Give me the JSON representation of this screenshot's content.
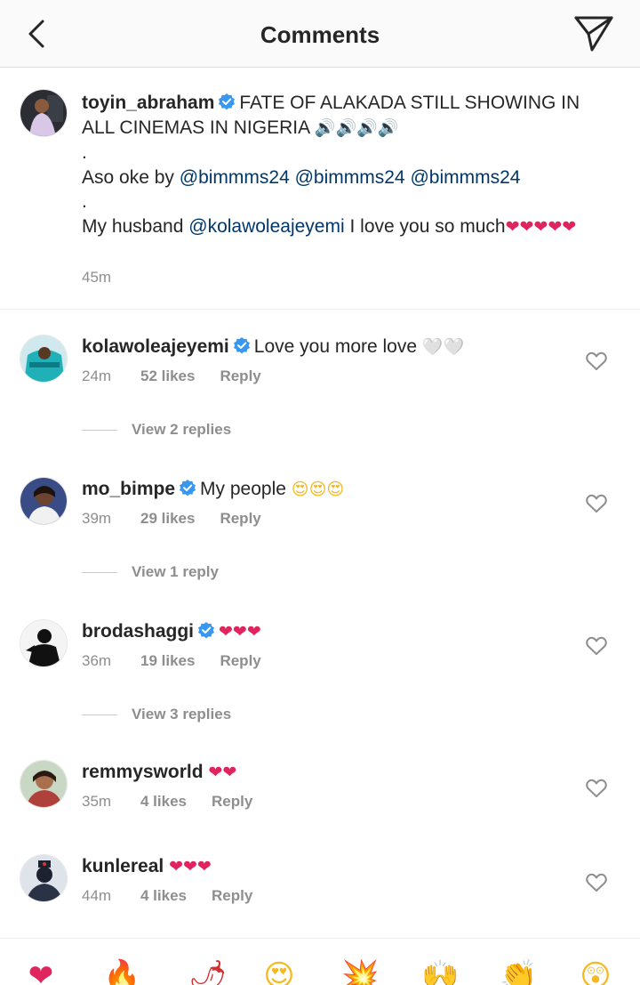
{
  "header": {
    "title": "Comments",
    "back_icon": "chevron-left-icon",
    "send_icon": "paper-plane-icon"
  },
  "post": {
    "username": "toyin_abraham",
    "line1_text": "FATE OF ALAKADA STILL SHOWING IN ALL CINEMAS IN NIGERIA",
    "line1_emoji": "🔊🔊🔊🔊",
    "dot1": ".",
    "line2_text": "Aso oke by",
    "mention1": "@bimmms24",
    "mention2": "@bimmms24",
    "mention3": "@bimmms24",
    "dot2": ".",
    "line3_text": "My husband",
    "mention4": "@kolawoleajeyemi",
    "line3_after": "I love you so much",
    "line3_emoji": "❤❤❤❤❤",
    "time": "45m"
  },
  "comments": [
    {
      "username": "kolawoleajeyemi",
      "text": "Love you more love",
      "emoji": "🤍🤍",
      "time": "24m",
      "likes": "52 likes",
      "reply": "Reply",
      "view_replies": "View 2 replies"
    },
    {
      "username": "mo_bimpe",
      "text": "My people",
      "emoji": "😍😍😍",
      "time": "39m",
      "likes": "29 likes",
      "reply": "Reply",
      "view_replies": "View 1 reply"
    },
    {
      "username": "brodashaggi",
      "text": "",
      "emoji": "❤❤❤",
      "time": "36m",
      "likes": "19 likes",
      "reply": "Reply",
      "view_replies": "View 3 replies"
    },
    {
      "username": "remmysworld",
      "text": "",
      "emoji": "❤❤",
      "time": "35m",
      "likes": "4 likes",
      "reply": "Reply",
      "view_replies": ""
    },
    {
      "username": "kunlereal",
      "text": "",
      "emoji": "❤❤❤",
      "time": "44m",
      "likes": "4 likes",
      "reply": "Reply",
      "view_replies": ""
    }
  ],
  "emoji_bar": [
    "❤",
    "🔥",
    "🌶",
    "😍",
    "💥",
    "🙌",
    "👏",
    "😲"
  ],
  "colors": {
    "verified": "#3897f0",
    "mention": "#00376b",
    "meta": "#8e8e8e",
    "heart": "#e0245e"
  }
}
